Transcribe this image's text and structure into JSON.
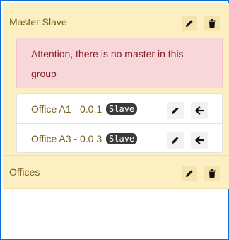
{
  "groups": [
    {
      "title": "Master Slave",
      "alert": "Attention, there is no master in this group",
      "items": [
        {
          "name": "Office A1 - 0.0.1",
          "badge": "Slave"
        },
        {
          "name": "Office A3 - 0.0.3",
          "badge": "Slave"
        }
      ]
    },
    {
      "title": "Offices"
    }
  ],
  "icons": {
    "edit": "pencil-icon",
    "delete": "trash-icon",
    "back": "arrow-left-icon"
  },
  "colors": {
    "group_bg": "#fcefc2",
    "group_text": "#785f1f",
    "alert_bg": "#f8d7da",
    "alert_text": "#842029",
    "badge_bg": "#3a3a3a",
    "frame_border": "#0d6fd1"
  }
}
